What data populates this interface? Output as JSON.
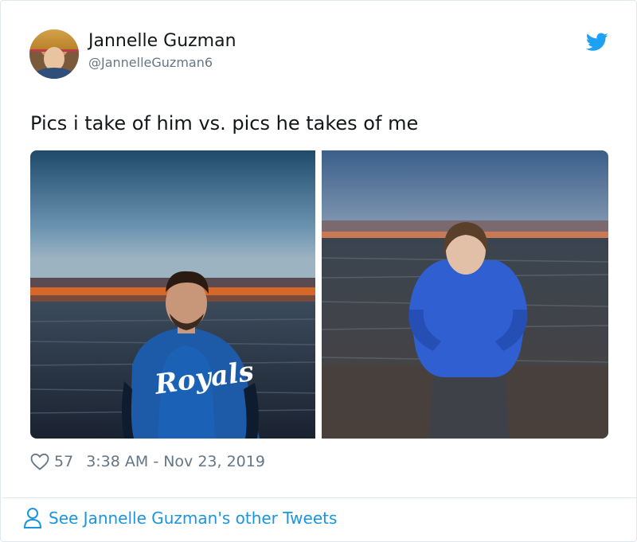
{
  "tweet": {
    "author_name": "Jannelle Guzman",
    "author_handle": "@JannelleGuzman6",
    "text": "Pics i take of him vs. pics he takes of me",
    "likes": "57",
    "timestamp": "3:38 AM - Nov 23, 2019",
    "images": [
      {
        "jacket_text": "Royals"
      },
      {}
    ]
  },
  "footer": {
    "link_label": "See Jannelle Guzman's other Tweets"
  },
  "colors": {
    "brand_blue": "#1da1f2",
    "link_blue": "#1b95e0",
    "muted_text": "#657786"
  },
  "icons": {
    "brand": "twitter-bird-icon",
    "like": "heart-icon",
    "profile": "person-icon"
  }
}
